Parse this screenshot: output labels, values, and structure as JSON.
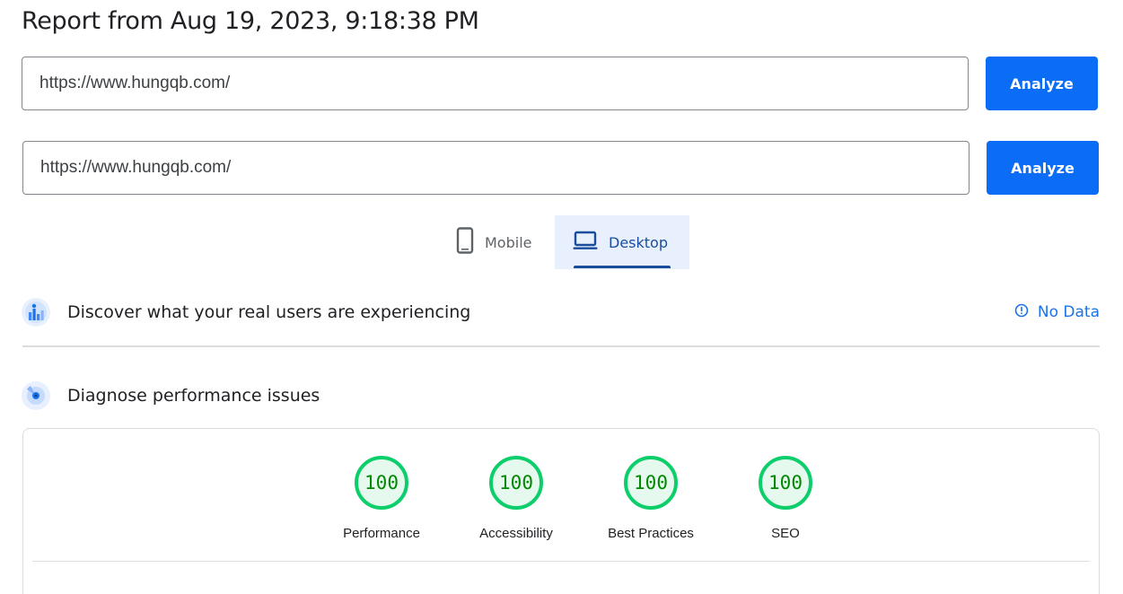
{
  "report_title": "Report from Aug 19, 2023, 9:18:38 PM",
  "url_inputs": [
    {
      "value": "https://www.hungqb.com/",
      "button_label": "Analyze"
    },
    {
      "value": "https://www.hungqb.com/",
      "button_label": "Analyze"
    }
  ],
  "device_tabs": [
    {
      "label": "Mobile",
      "icon": "phone-icon",
      "selected": false
    },
    {
      "label": "Desktop",
      "icon": "laptop-icon",
      "selected": true
    }
  ],
  "crux_section": {
    "title": "Discover what your real users are experiencing",
    "icon": "users-chart-icon",
    "status_icon": "info-icon",
    "status_text": "No Data"
  },
  "diagnose_section": {
    "title": "Diagnose performance issues",
    "icon": "lighthouse-icon"
  },
  "scores": [
    {
      "value": "100",
      "label": "Performance"
    },
    {
      "value": "100",
      "label": "Accessibility"
    },
    {
      "value": "100",
      "label": "Best Practices"
    },
    {
      "value": "100",
      "label": "SEO"
    }
  ],
  "colors": {
    "accent_blue": "#0b6cf5",
    "tab_selected_bg": "#e8f0fe",
    "tab_selected_text": "#1a4c9c",
    "score_good_ring": "#0cce6b",
    "score_good_text": "#008800",
    "link_blue": "#1a73e8"
  }
}
